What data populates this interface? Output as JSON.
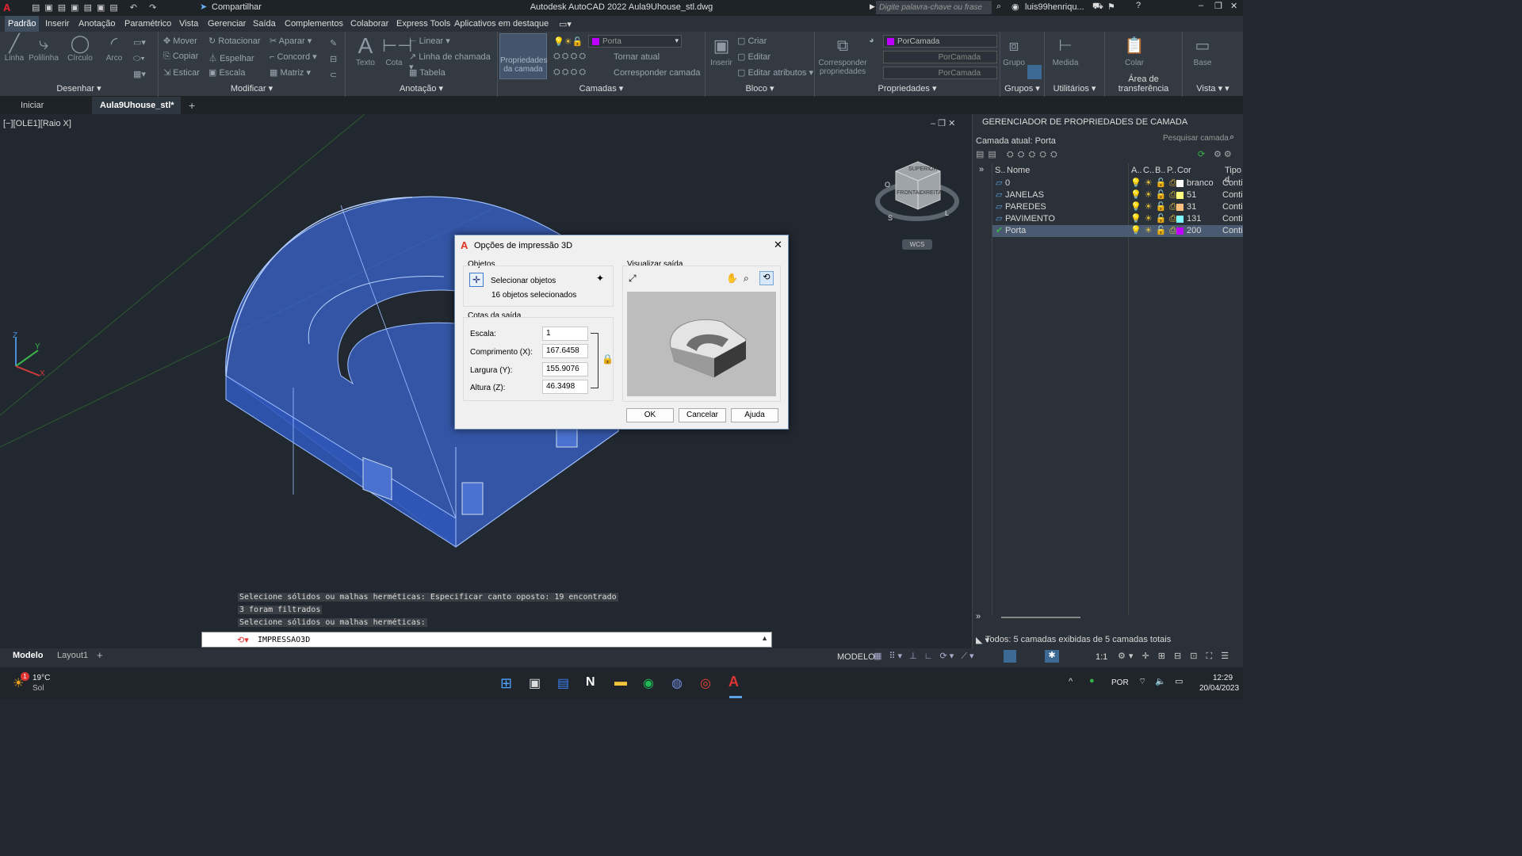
{
  "window": {
    "title": "Autodesk AutoCAD 2022   Aula9Uhouse_stl.dwg",
    "share": "Compartilhar",
    "search_placeholder": "Digite palavra-chave ou frase",
    "user": "luis99henriqu..."
  },
  "menu": [
    "Padrão",
    "Inserir",
    "Anotação",
    "Paramétrico",
    "Vista",
    "Gerenciar",
    "Saída",
    "Complementos",
    "Colaborar",
    "Express Tools",
    "Aplicativos em destaque"
  ],
  "ribbon": {
    "draw": {
      "label": "Desenhar",
      "tools": [
        "Linha",
        "Polilinha",
        "Círculo",
        "Arco"
      ]
    },
    "modify": {
      "label": "Modificar",
      "tools": [
        "Mover",
        "Rotacionar",
        "Aparar",
        "Copiar",
        "Espelhar",
        "Concord",
        "Esticar",
        "Escala",
        "Matriz"
      ]
    },
    "annotation": {
      "label": "Anotação",
      "tools": [
        "Texto",
        "Cota",
        "Linear",
        "Linha de chamada",
        "Tabela"
      ]
    },
    "layers": {
      "label": "Camadas",
      "props": "Propriedades da camada",
      "current": "Porta",
      "tools": [
        "Tornar atual",
        "Corresponder camada"
      ]
    },
    "block": {
      "label": "Bloco",
      "insert": "Inserir",
      "tools": [
        "Criar",
        "Editar",
        "Editar atributos"
      ]
    },
    "properties": {
      "label": "Propriedades",
      "match": "Corresponder propriedades",
      "v1": "PorCamada",
      "v2": "PorCamada",
      "v3": "PorCamada"
    },
    "groups": {
      "label": "Grupos",
      "tool": "Grupo"
    },
    "utilities": {
      "label": "Utilitários",
      "tool": "Medida"
    },
    "clipboard": {
      "label": "Área de transferência",
      "tool": "Colar"
    },
    "view": {
      "label": "Vista",
      "tool": "Base"
    }
  },
  "tabs": [
    "Iniciar",
    "Aula9Uhouse_stl*"
  ],
  "viewport": {
    "label": "[−][OLE1][Raio X]",
    "wcs": "WCS",
    "cube": [
      "SUPERIOR",
      "FRONTAL",
      "DIREITA"
    ],
    "compass": [
      "O",
      "S",
      "L"
    ]
  },
  "palette": {
    "title": "GERENCIADOR DE PROPRIEDADES DE CAMADA",
    "current": "Camada atual: Porta",
    "search": "Pesquisar camada",
    "cols": [
      "S..",
      "Nome",
      "A..",
      "C..",
      "B..",
      "P..",
      "Cor",
      "Tipo d"
    ],
    "layers": [
      {
        "name": "0",
        "color": "branco",
        "hex": "#ffffff"
      },
      {
        "name": "JANELAS",
        "color": "51",
        "hex": "#ffff7f"
      },
      {
        "name": "PAREDES",
        "color": "31",
        "hex": "#ffbf7f"
      },
      {
        "name": "PAVIMENTO",
        "color": "131",
        "hex": "#7fffff"
      },
      {
        "name": "Porta",
        "color": "200",
        "hex": "#bf00ff"
      }
    ],
    "type_val": "Conti",
    "footer": "Todos: 5 camadas exibidas de 5 camadas totais"
  },
  "dialog": {
    "title": "Opções de impressão 3D",
    "objects_group": "Objetos",
    "select": "Selecionar objetos",
    "count": "16 objetos selecionados",
    "dims_group": "Cotas da saída",
    "preview_group": "Visualizar saída",
    "fields": [
      {
        "label": "Escala:",
        "value": "1"
      },
      {
        "label": "Comprimento (X):",
        "value": "167.6458"
      },
      {
        "label": "Largura (Y):",
        "value": "155.9076"
      },
      {
        "label": "Altura (Z):",
        "value": "46.3498"
      }
    ],
    "ok": "OK",
    "cancel": "Cancelar",
    "help": "Ajuda"
  },
  "command": {
    "history": [
      "Selecione sólidos ou malhas herméticas: Especificar canto oposto: 19 encontrado",
      "3 foram filtrados",
      "Selecione sólidos ou malhas herméticas:"
    ],
    "input": "IMPRESSAO3D"
  },
  "status": {
    "model_tab": "Modelo",
    "layout_tab": "Layout1",
    "mode": "MODELO",
    "scale": "1:1"
  },
  "taskbar": {
    "temp": "19°C",
    "weather": "Sol",
    "badge": "1",
    "lang": "POR",
    "time": "12:29",
    "date": "20/04/2023"
  }
}
